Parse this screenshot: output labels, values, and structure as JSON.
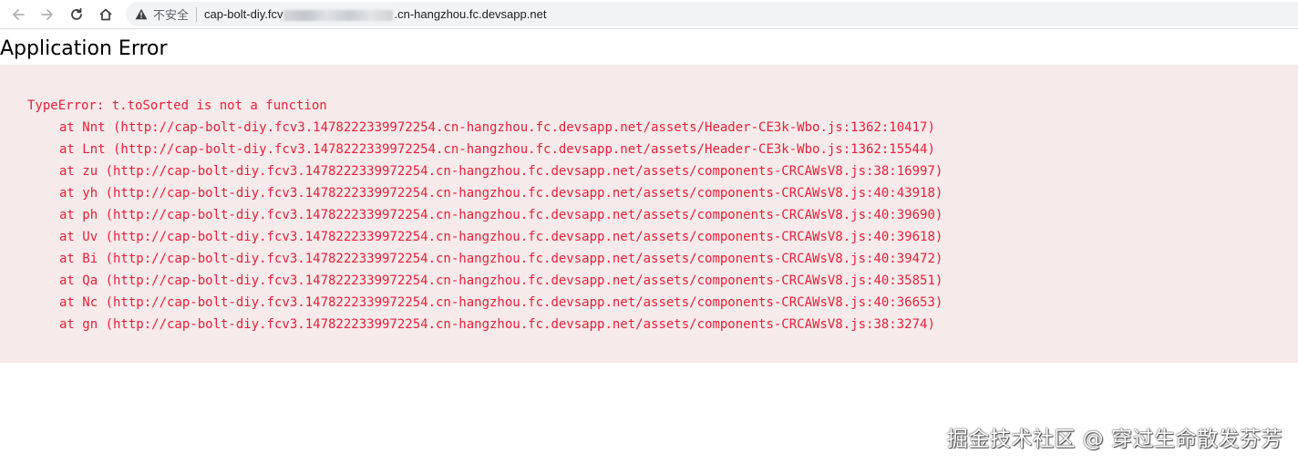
{
  "browser": {
    "security_label": "不安全",
    "url_prefix": "cap-bolt-diy.fcv",
    "url_suffix": ".cn-hangzhou.fc.devsapp.net",
    "icons": {
      "back": "arrow-left-icon",
      "forward": "arrow-right-icon",
      "reload": "reload-icon",
      "home": "home-icon",
      "security": "warning-triangle-icon"
    }
  },
  "page": {
    "title": "Application Error",
    "error_message": "TypeError: t.toSorted is not a function",
    "stack": [
      "at Nnt (http://cap-bolt-diy.fcv3.1478222339972254.cn-hangzhou.fc.devsapp.net/assets/Header-CE3k-Wbo.js:1362:10417)",
      "at Lnt (http://cap-bolt-diy.fcv3.1478222339972254.cn-hangzhou.fc.devsapp.net/assets/Header-CE3k-Wbo.js:1362:15544)",
      "at zu (http://cap-bolt-diy.fcv3.1478222339972254.cn-hangzhou.fc.devsapp.net/assets/components-CRCAWsV8.js:38:16997)",
      "at yh (http://cap-bolt-diy.fcv3.1478222339972254.cn-hangzhou.fc.devsapp.net/assets/components-CRCAWsV8.js:40:43918)",
      "at ph (http://cap-bolt-diy.fcv3.1478222339972254.cn-hangzhou.fc.devsapp.net/assets/components-CRCAWsV8.js:40:39690)",
      "at Uv (http://cap-bolt-diy.fcv3.1478222339972254.cn-hangzhou.fc.devsapp.net/assets/components-CRCAWsV8.js:40:39618)",
      "at Bi (http://cap-bolt-diy.fcv3.1478222339972254.cn-hangzhou.fc.devsapp.net/assets/components-CRCAWsV8.js:40:39472)",
      "at Qa (http://cap-bolt-diy.fcv3.1478222339972254.cn-hangzhou.fc.devsapp.net/assets/components-CRCAWsV8.js:40:35851)",
      "at Nc (http://cap-bolt-diy.fcv3.1478222339972254.cn-hangzhou.fc.devsapp.net/assets/components-CRCAWsV8.js:40:36653)",
      "at gn (http://cap-bolt-diy.fcv3.1478222339972254.cn-hangzhou.fc.devsapp.net/assets/components-CRCAWsV8.js:38:3274)"
    ]
  },
  "watermark": "掘金技术社区 @ 穿过生命散发芬芳",
  "colors": {
    "error_text": "#e8203a",
    "error_background": "#f6eaea",
    "omnibox_background": "#f1f3f4"
  }
}
